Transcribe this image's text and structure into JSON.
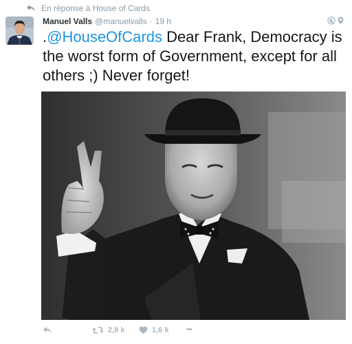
{
  "reply_context": {
    "text": "En réponse à House of Cards"
  },
  "tweet": {
    "author_name": "Manuel Valls",
    "author_handle": "@manuelvalls",
    "separator": "·",
    "time": "19 h",
    "text_prefix": ".",
    "mention": "@HouseOfCards",
    "text_body": " Dear Frank, Democracy is the worst form of Government, except for all others ;) Never forget!"
  },
  "actions": {
    "retweets": "2,8 k",
    "likes": "1,6 k",
    "more_label": "•••"
  },
  "colors": {
    "link": "#1b95e0",
    "muted": "#8899a6",
    "action_gray": "#aab8c2",
    "text": "#14171a"
  },
  "icons": [
    "reply-arrow-icon",
    "globe-icon",
    "location-pin-icon",
    "reply-icon",
    "retweet-icon",
    "heart-icon",
    "more-icon"
  ]
}
